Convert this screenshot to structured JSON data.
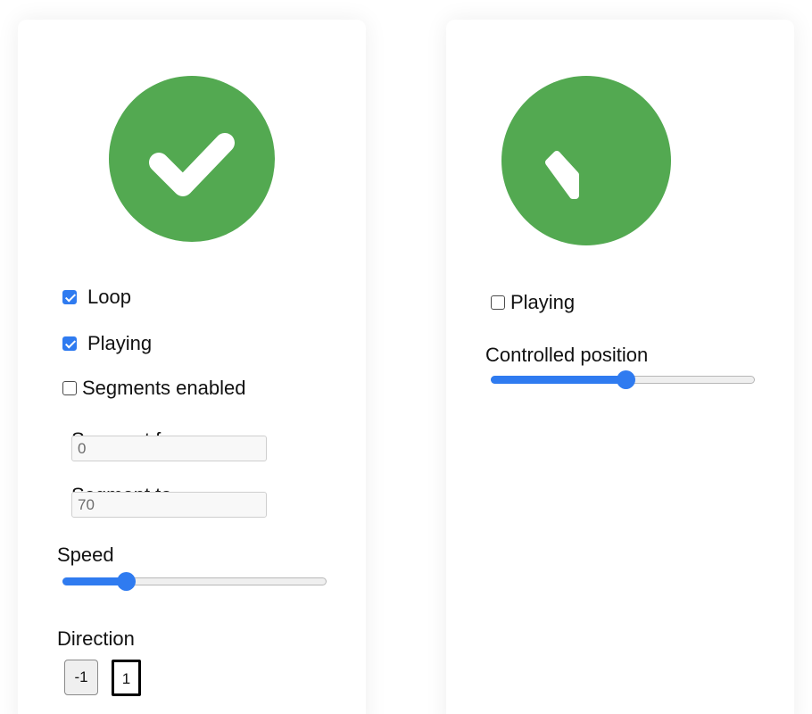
{
  "left_panel": {
    "loop": {
      "label": "Loop",
      "checked": true
    },
    "playing": {
      "label": "Playing",
      "checked": true
    },
    "segments_enabled": {
      "label": "Segments enabled",
      "checked": false
    },
    "segment_from": {
      "label": "Segment from",
      "value": "0"
    },
    "segment_to": {
      "label": "Segment to",
      "value": "70"
    },
    "speed": {
      "label": "Speed",
      "value": 0.22
    },
    "direction": {
      "label": "Direction",
      "buttons": [
        "-1",
        "1"
      ],
      "active": "1"
    },
    "animation": {
      "icon": "checkmark-icon",
      "color": "#53a951"
    }
  },
  "right_panel": {
    "playing": {
      "label": "Playing",
      "checked": false
    },
    "controlled_position": {
      "label": "Controlled position",
      "value": 0.51
    },
    "animation": {
      "icon": "partial-checkmark-icon",
      "color": "#53a951"
    }
  },
  "colors": {
    "accent": "#2f7bf0",
    "animation_green": "#53a951"
  }
}
